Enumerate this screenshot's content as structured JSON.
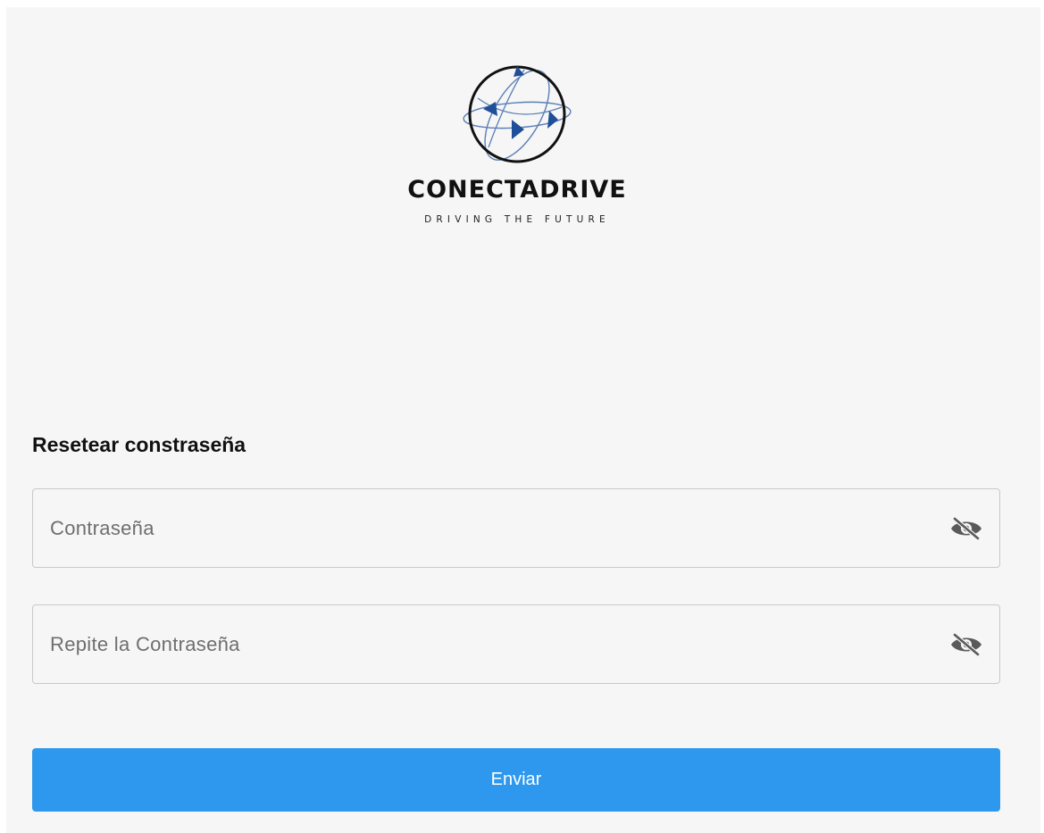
{
  "brand": {
    "name": "CONECTADRIVE",
    "tagline": "DRIVING THE FUTURE",
    "logo_icon": "globe-with-arrows-icon",
    "colors": {
      "ring": "#111111",
      "orbits": "#5a7fb6",
      "arrows": "#1f4f99"
    }
  },
  "form": {
    "title": "Resetear constraseña",
    "password": {
      "placeholder": "Contraseña",
      "value": "",
      "toggle_icon": "eye-off-icon"
    },
    "repeat_password": {
      "placeholder": "Repite la Contraseña",
      "value": "",
      "toggle_icon": "eye-off-icon"
    },
    "submit_label": "Enviar"
  },
  "colors": {
    "background": "#f6f6f6",
    "primary": "#2d98ee",
    "field_border": "#c9c9c9"
  }
}
